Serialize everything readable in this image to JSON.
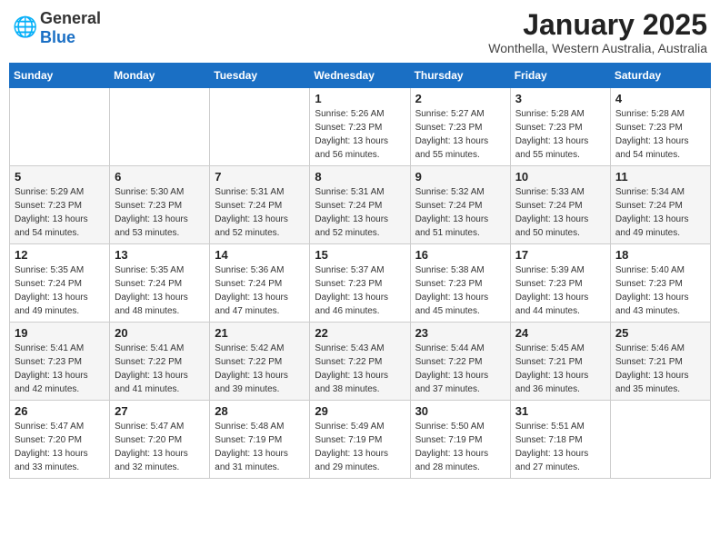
{
  "header": {
    "logo_general": "General",
    "logo_blue": "Blue",
    "title": "January 2025",
    "subtitle": "Wonthella, Western Australia, Australia"
  },
  "calendar": {
    "days_of_week": [
      "Sunday",
      "Monday",
      "Tuesday",
      "Wednesday",
      "Thursday",
      "Friday",
      "Saturday"
    ],
    "weeks": [
      [
        {
          "day": "",
          "sunrise": "",
          "sunset": "",
          "daylight": ""
        },
        {
          "day": "",
          "sunrise": "",
          "sunset": "",
          "daylight": ""
        },
        {
          "day": "",
          "sunrise": "",
          "sunset": "",
          "daylight": ""
        },
        {
          "day": "1",
          "sunrise": "Sunrise: 5:26 AM",
          "sunset": "Sunset: 7:23 PM",
          "daylight": "Daylight: 13 hours and 56 minutes."
        },
        {
          "day": "2",
          "sunrise": "Sunrise: 5:27 AM",
          "sunset": "Sunset: 7:23 PM",
          "daylight": "Daylight: 13 hours and 55 minutes."
        },
        {
          "day": "3",
          "sunrise": "Sunrise: 5:28 AM",
          "sunset": "Sunset: 7:23 PM",
          "daylight": "Daylight: 13 hours and 55 minutes."
        },
        {
          "day": "4",
          "sunrise": "Sunrise: 5:28 AM",
          "sunset": "Sunset: 7:23 PM",
          "daylight": "Daylight: 13 hours and 54 minutes."
        }
      ],
      [
        {
          "day": "5",
          "sunrise": "Sunrise: 5:29 AM",
          "sunset": "Sunset: 7:23 PM",
          "daylight": "Daylight: 13 hours and 54 minutes."
        },
        {
          "day": "6",
          "sunrise": "Sunrise: 5:30 AM",
          "sunset": "Sunset: 7:23 PM",
          "daylight": "Daylight: 13 hours and 53 minutes."
        },
        {
          "day": "7",
          "sunrise": "Sunrise: 5:31 AM",
          "sunset": "Sunset: 7:24 PM",
          "daylight": "Daylight: 13 hours and 52 minutes."
        },
        {
          "day": "8",
          "sunrise": "Sunrise: 5:31 AM",
          "sunset": "Sunset: 7:24 PM",
          "daylight": "Daylight: 13 hours and 52 minutes."
        },
        {
          "day": "9",
          "sunrise": "Sunrise: 5:32 AM",
          "sunset": "Sunset: 7:24 PM",
          "daylight": "Daylight: 13 hours and 51 minutes."
        },
        {
          "day": "10",
          "sunrise": "Sunrise: 5:33 AM",
          "sunset": "Sunset: 7:24 PM",
          "daylight": "Daylight: 13 hours and 50 minutes."
        },
        {
          "day": "11",
          "sunrise": "Sunrise: 5:34 AM",
          "sunset": "Sunset: 7:24 PM",
          "daylight": "Daylight: 13 hours and 49 minutes."
        }
      ],
      [
        {
          "day": "12",
          "sunrise": "Sunrise: 5:35 AM",
          "sunset": "Sunset: 7:24 PM",
          "daylight": "Daylight: 13 hours and 49 minutes."
        },
        {
          "day": "13",
          "sunrise": "Sunrise: 5:35 AM",
          "sunset": "Sunset: 7:24 PM",
          "daylight": "Daylight: 13 hours and 48 minutes."
        },
        {
          "day": "14",
          "sunrise": "Sunrise: 5:36 AM",
          "sunset": "Sunset: 7:24 PM",
          "daylight": "Daylight: 13 hours and 47 minutes."
        },
        {
          "day": "15",
          "sunrise": "Sunrise: 5:37 AM",
          "sunset": "Sunset: 7:23 PM",
          "daylight": "Daylight: 13 hours and 46 minutes."
        },
        {
          "day": "16",
          "sunrise": "Sunrise: 5:38 AM",
          "sunset": "Sunset: 7:23 PM",
          "daylight": "Daylight: 13 hours and 45 minutes."
        },
        {
          "day": "17",
          "sunrise": "Sunrise: 5:39 AM",
          "sunset": "Sunset: 7:23 PM",
          "daylight": "Daylight: 13 hours and 44 minutes."
        },
        {
          "day": "18",
          "sunrise": "Sunrise: 5:40 AM",
          "sunset": "Sunset: 7:23 PM",
          "daylight": "Daylight: 13 hours and 43 minutes."
        }
      ],
      [
        {
          "day": "19",
          "sunrise": "Sunrise: 5:41 AM",
          "sunset": "Sunset: 7:23 PM",
          "daylight": "Daylight: 13 hours and 42 minutes."
        },
        {
          "day": "20",
          "sunrise": "Sunrise: 5:41 AM",
          "sunset": "Sunset: 7:22 PM",
          "daylight": "Daylight: 13 hours and 41 minutes."
        },
        {
          "day": "21",
          "sunrise": "Sunrise: 5:42 AM",
          "sunset": "Sunset: 7:22 PM",
          "daylight": "Daylight: 13 hours and 39 minutes."
        },
        {
          "day": "22",
          "sunrise": "Sunrise: 5:43 AM",
          "sunset": "Sunset: 7:22 PM",
          "daylight": "Daylight: 13 hours and 38 minutes."
        },
        {
          "day": "23",
          "sunrise": "Sunrise: 5:44 AM",
          "sunset": "Sunset: 7:22 PM",
          "daylight": "Daylight: 13 hours and 37 minutes."
        },
        {
          "day": "24",
          "sunrise": "Sunrise: 5:45 AM",
          "sunset": "Sunset: 7:21 PM",
          "daylight": "Daylight: 13 hours and 36 minutes."
        },
        {
          "day": "25",
          "sunrise": "Sunrise: 5:46 AM",
          "sunset": "Sunset: 7:21 PM",
          "daylight": "Daylight: 13 hours and 35 minutes."
        }
      ],
      [
        {
          "day": "26",
          "sunrise": "Sunrise: 5:47 AM",
          "sunset": "Sunset: 7:20 PM",
          "daylight": "Daylight: 13 hours and 33 minutes."
        },
        {
          "day": "27",
          "sunrise": "Sunrise: 5:47 AM",
          "sunset": "Sunset: 7:20 PM",
          "daylight": "Daylight: 13 hours and 32 minutes."
        },
        {
          "day": "28",
          "sunrise": "Sunrise: 5:48 AM",
          "sunset": "Sunset: 7:19 PM",
          "daylight": "Daylight: 13 hours and 31 minutes."
        },
        {
          "day": "29",
          "sunrise": "Sunrise: 5:49 AM",
          "sunset": "Sunset: 7:19 PM",
          "daylight": "Daylight: 13 hours and 29 minutes."
        },
        {
          "day": "30",
          "sunrise": "Sunrise: 5:50 AM",
          "sunset": "Sunset: 7:19 PM",
          "daylight": "Daylight: 13 hours and 28 minutes."
        },
        {
          "day": "31",
          "sunrise": "Sunrise: 5:51 AM",
          "sunset": "Sunset: 7:18 PM",
          "daylight": "Daylight: 13 hours and 27 minutes."
        },
        {
          "day": "",
          "sunrise": "",
          "sunset": "",
          "daylight": ""
        }
      ]
    ]
  }
}
